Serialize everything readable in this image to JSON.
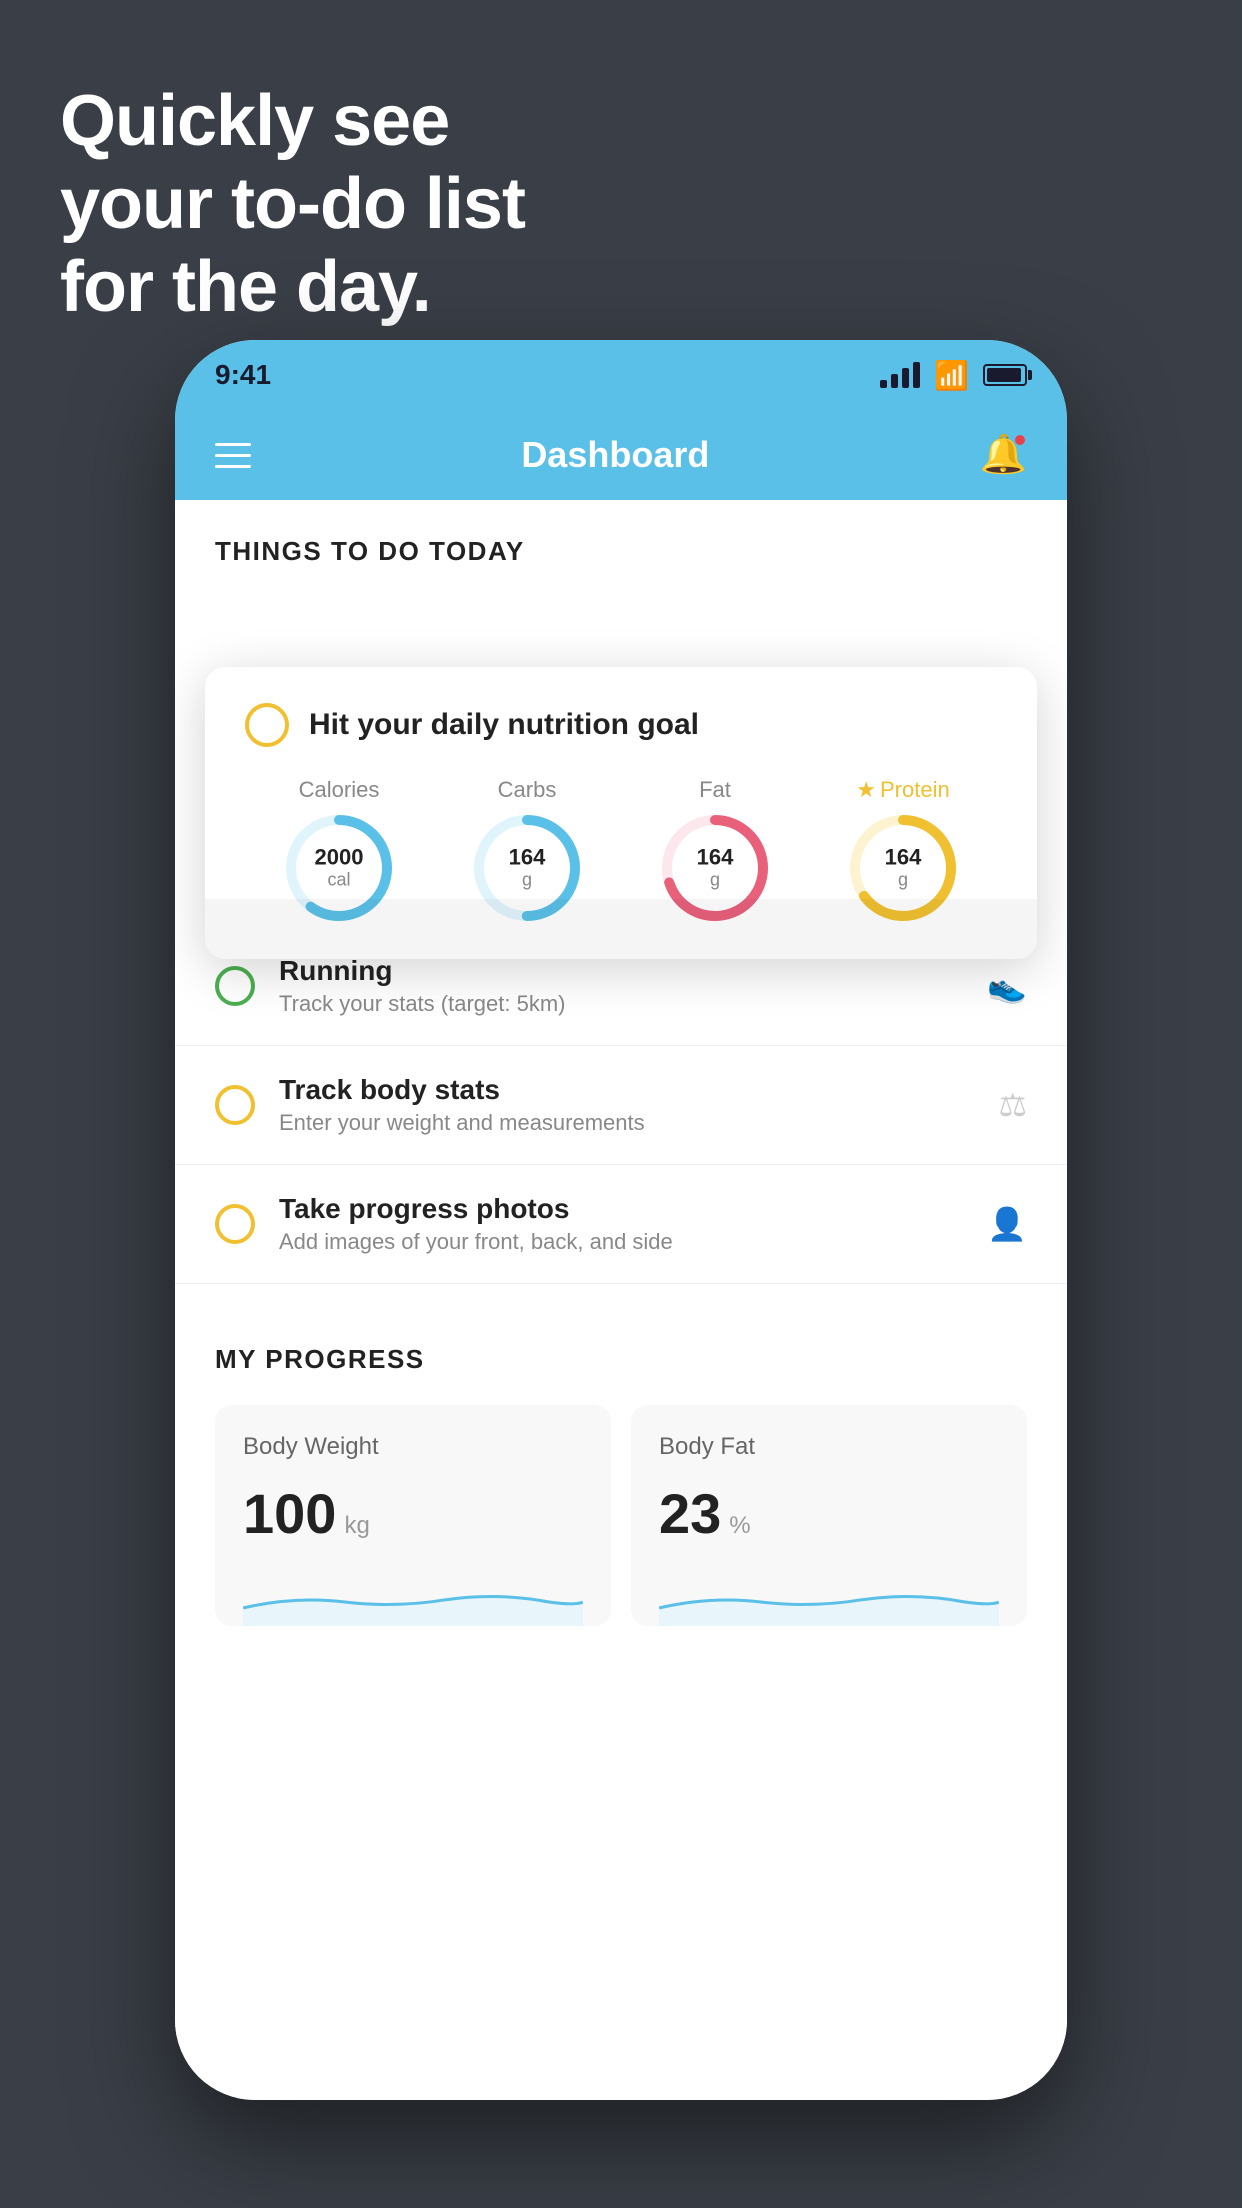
{
  "headline": {
    "line1": "Quickly see",
    "line2": "your to-do list",
    "line3": "for the day."
  },
  "status_bar": {
    "time": "9:41"
  },
  "header": {
    "title": "Dashboard"
  },
  "things_section": {
    "label": "THINGS TO DO TODAY"
  },
  "nutrition_card": {
    "circle_label": "",
    "title": "Hit your daily nutrition goal",
    "macros": [
      {
        "label": "Calories",
        "value": "2000",
        "unit": "cal",
        "color": "#5bc0e8",
        "track_color": "#e0f4fc",
        "progress": 0.6
      },
      {
        "label": "Carbs",
        "value": "164",
        "unit": "g",
        "color": "#5bc0e8",
        "track_color": "#e0f4fc",
        "progress": 0.5
      },
      {
        "label": "Fat",
        "value": "164",
        "unit": "g",
        "color": "#e8607a",
        "track_color": "#fce8ec",
        "progress": 0.7
      },
      {
        "label": "Protein",
        "value": "164",
        "unit": "g",
        "color": "#f0c030",
        "track_color": "#fdf3d0",
        "progress": 0.65,
        "starred": true
      }
    ]
  },
  "todo_items": [
    {
      "id": "running",
      "title": "Running",
      "subtitle": "Track your stats (target: 5km)",
      "circle_style": "green",
      "icon": "shoe"
    },
    {
      "id": "body-stats",
      "title": "Track body stats",
      "subtitle": "Enter your weight and measurements",
      "circle_style": "yellow",
      "icon": "scale"
    },
    {
      "id": "progress-photos",
      "title": "Take progress photos",
      "subtitle": "Add images of your front, back, and side",
      "circle_style": "yellow",
      "icon": "person"
    }
  ],
  "progress_section": {
    "label": "MY PROGRESS",
    "cards": [
      {
        "title": "Body Weight",
        "value": "100",
        "unit": "kg"
      },
      {
        "title": "Body Fat",
        "value": "23",
        "unit": "%"
      }
    ]
  }
}
